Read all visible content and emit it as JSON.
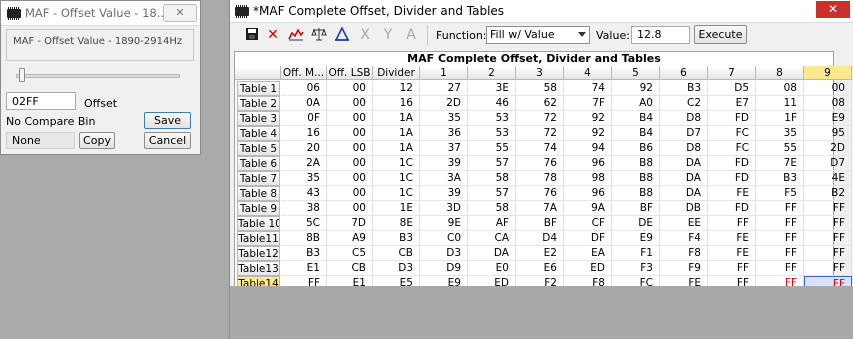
{
  "offset_window": {
    "title": "MAF - Offset Value - 18...",
    "close_glyph": "✕",
    "description": "MAF - Offset Value - 1890-2914Hz",
    "value": "02FF",
    "value_label": "Offset",
    "compare_label": "No Compare Bin",
    "compare_value": "None",
    "save_label": "Save",
    "copy_label": "Copy",
    "cancel_label": "Cancel"
  },
  "main_window": {
    "title": "*MAF Complete Offset, Divider and Tables",
    "close_glyph": "✕",
    "toolbar": {
      "icons": [
        "save-icon",
        "delete-icon",
        "graph-icon",
        "scale-icon",
        "interpolate-icon",
        "x-axis-icon",
        "y-axis-icon",
        "text-icon"
      ],
      "function_label": "Function:",
      "function_value": "Fill w/ Value",
      "value_label": "Value:",
      "value": "12.8",
      "execute_label": "Execute"
    },
    "grid": {
      "title": "MAF Complete Offset, Divider and Tables",
      "columns": [
        "Off. M...",
        "Off. LSB",
        "Divider",
        "1",
        "2",
        "3",
        "4",
        "5",
        "6",
        "7",
        "8",
        "9"
      ],
      "rows": [
        {
          "label": "Table 1",
          "cells": [
            "06",
            "00",
            "12",
            "27",
            "3E",
            "58",
            "74",
            "92",
            "B3",
            "D5",
            "08",
            "00"
          ]
        },
        {
          "label": "Table 2",
          "cells": [
            "0A",
            "00",
            "16",
            "2D",
            "46",
            "62",
            "7F",
            "A0",
            "C2",
            "E7",
            "11",
            "08"
          ]
        },
        {
          "label": "Table 3",
          "cells": [
            "0F",
            "00",
            "1A",
            "35",
            "53",
            "72",
            "92",
            "B4",
            "D8",
            "FD",
            "1F",
            "E9"
          ]
        },
        {
          "label": "Table 4",
          "cells": [
            "16",
            "00",
            "1A",
            "36",
            "53",
            "72",
            "92",
            "B4",
            "D7",
            "FC",
            "35",
            "95"
          ]
        },
        {
          "label": "Table 5",
          "cells": [
            "20",
            "00",
            "1A",
            "37",
            "55",
            "74",
            "94",
            "B6",
            "D8",
            "FC",
            "55",
            "2D"
          ]
        },
        {
          "label": "Table 6",
          "cells": [
            "2A",
            "00",
            "1C",
            "39",
            "57",
            "76",
            "96",
            "B8",
            "DA",
            "FD",
            "7E",
            "D7"
          ]
        },
        {
          "label": "Table 7",
          "cells": [
            "35",
            "00",
            "1C",
            "3A",
            "58",
            "78",
            "98",
            "B8",
            "DA",
            "FD",
            "B3",
            "4E"
          ]
        },
        {
          "label": "Table 8",
          "cells": [
            "43",
            "00",
            "1C",
            "39",
            "57",
            "76",
            "96",
            "B8",
            "DA",
            "FE",
            "F5",
            "B2"
          ]
        },
        {
          "label": "Table 9",
          "cells": [
            "38",
            "00",
            "1E",
            "3D",
            "58",
            "7A",
            "9A",
            "BF",
            "DB",
            "FD",
            "FF",
            "FF"
          ]
        },
        {
          "label": "Table 10",
          "cells": [
            "5C",
            "7D",
            "8E",
            "9E",
            "AF",
            "BF",
            "CF",
            "DE",
            "EE",
            "FF",
            "FF",
            "FF"
          ]
        },
        {
          "label": "Table11",
          "cells": [
            "8B",
            "A9",
            "B3",
            "C0",
            "CA",
            "D4",
            "DF",
            "E9",
            "F4",
            "FE",
            "FF",
            "FF"
          ]
        },
        {
          "label": "Table12",
          "cells": [
            "B3",
            "C5",
            "CB",
            "D3",
            "DA",
            "E2",
            "EA",
            "F1",
            "F8",
            "FE",
            "FF",
            "FF"
          ]
        },
        {
          "label": "Table13",
          "cells": [
            "E1",
            "CB",
            "D3",
            "D9",
            "E0",
            "E6",
            "ED",
            "F3",
            "F9",
            "FF",
            "FF",
            "FF"
          ]
        },
        {
          "label": "Table14",
          "cells": [
            "FF",
            "E1",
            "E5",
            "E9",
            "ED",
            "F2",
            "F8",
            "FC",
            "FE",
            "FF",
            "FF",
            "FF"
          ]
        }
      ],
      "highlight_column": "9",
      "highlight_row": "Table14",
      "red_cells": [
        "13-10"
      ],
      "selected_cell": "13-11",
      "colors": {
        "highlight": "#ffe98a",
        "changed_text": "#e00000",
        "selection": "#d7e3f7"
      }
    }
  }
}
